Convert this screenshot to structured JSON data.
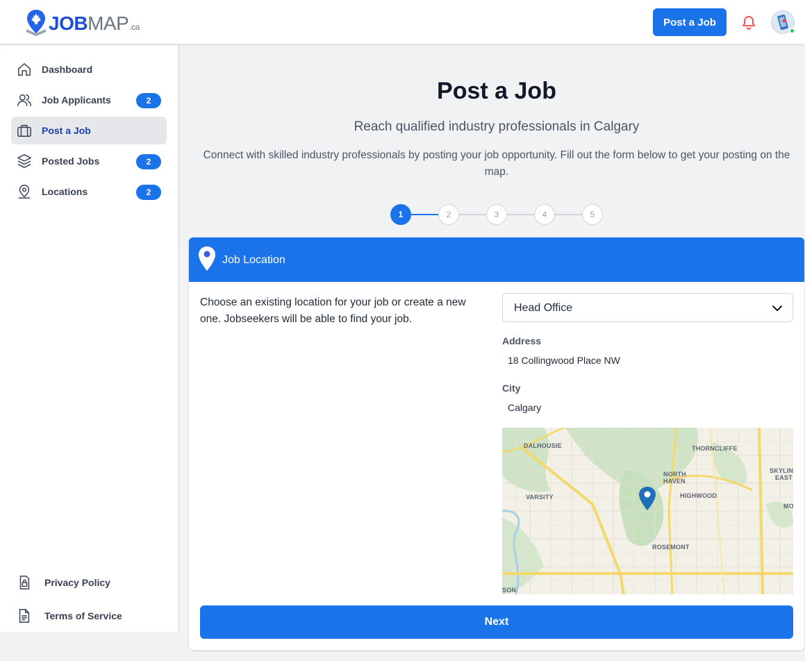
{
  "header": {
    "logo": {
      "text_job": "JOB",
      "text_map": "MAP",
      "text_ca": ".ca"
    },
    "post_job_label": "Post a Job",
    "notifications_icon": "bell-icon",
    "avatar_icon": "avatar"
  },
  "sidebar": {
    "items": [
      {
        "label": "Dashboard",
        "icon": "home-icon",
        "badge": null,
        "active": false
      },
      {
        "label": "Job Applicants",
        "icon": "users-icon",
        "badge": "2",
        "active": false
      },
      {
        "label": "Post a Job",
        "icon": "briefcase-icon",
        "badge": null,
        "active": true
      },
      {
        "label": "Posted Jobs",
        "icon": "layers-icon",
        "badge": "2",
        "active": false
      },
      {
        "label": "Locations",
        "icon": "location-user-icon",
        "badge": "2",
        "active": false
      }
    ],
    "footer": [
      {
        "label": "Privacy Policy",
        "icon": "lock-icon"
      },
      {
        "label": "Terms of Service",
        "icon": "document-icon"
      }
    ]
  },
  "main": {
    "title": "Post a Job",
    "subtitle": "Reach qualified industry professionals in Calgary",
    "description": "Connect with skilled industry professionals by posting your job opportunity. Fill out the form below to get your posting on the map.",
    "stepper": {
      "steps": [
        "1",
        "2",
        "3",
        "4",
        "5"
      ],
      "current": 1
    },
    "card": {
      "title": "Job Location",
      "intro": "Choose an existing location for your job or create a new one. Jobseekers will be able to find your job.",
      "location_select": {
        "value": "Head Office"
      },
      "address": {
        "label": "Address",
        "value": "18 Collingwood Place NW"
      },
      "city": {
        "label": "City",
        "value": "Calgary"
      },
      "map": {
        "labels": [
          "DALHOUSIE",
          "THORNCLIFFE",
          "NORTH",
          "HAVEN",
          "SKYLINE",
          "EAST",
          "VARSITY",
          "HIGHWOOD",
          "MO",
          "ROSEMONT",
          "SON"
        ],
        "pin_icon": "map-pin-icon"
      },
      "next_label": "Next"
    }
  },
  "colors": {
    "primary": "#1a73e8",
    "badge": "#1a73e8",
    "online": "#22c55e",
    "bell": "#ef4444"
  }
}
